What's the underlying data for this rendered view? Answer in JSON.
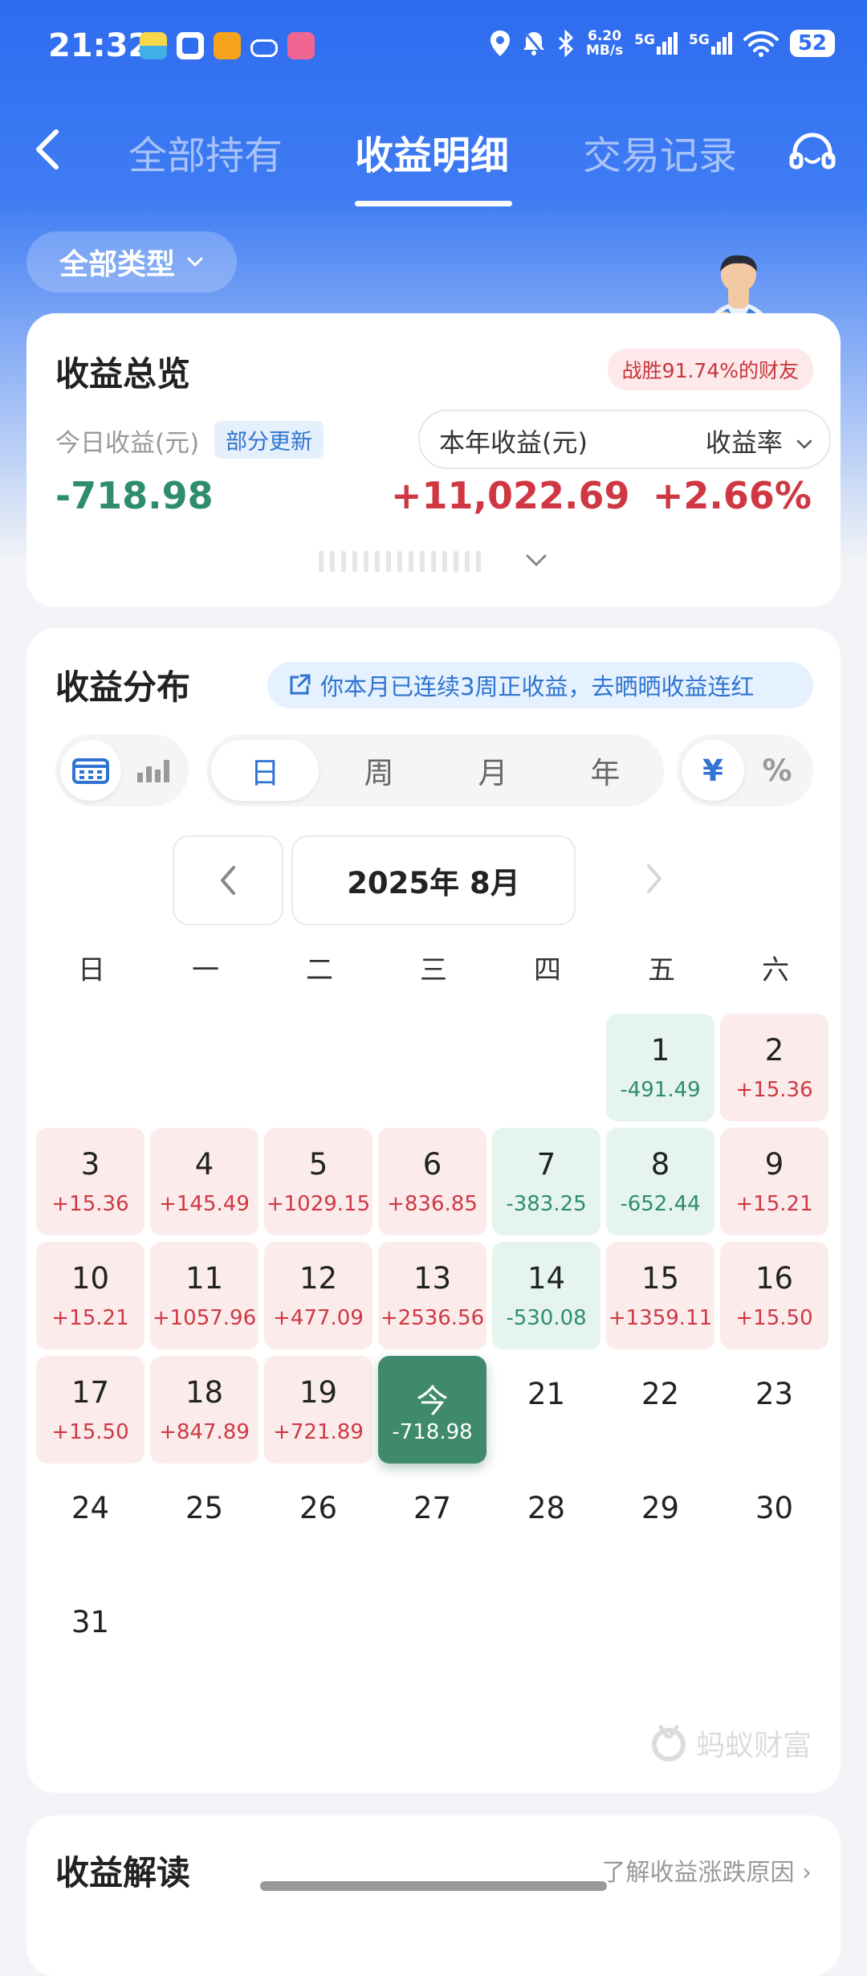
{
  "status_bar": {
    "time": "21:32",
    "net_speed_value": "6.20",
    "net_speed_unit": "MB/s",
    "sim1": "5G",
    "sim2": "5G",
    "battery": "52"
  },
  "nav": {
    "tabs": [
      {
        "label": "全部持有",
        "active": false
      },
      {
        "label": "收益明细",
        "active": true
      },
      {
        "label": "交易记录",
        "active": false
      }
    ]
  },
  "filter": {
    "type_label": "全部类型"
  },
  "overview": {
    "title": "收益总览",
    "win_badge": "战胜91.74%的财友",
    "today_label": "今日收益(元)",
    "partial_badge": "部分更新",
    "year_label": "本年收益(元)",
    "rate_label": "收益率",
    "today_value": "-718.98",
    "year_value": "+11,022.69",
    "rate_value": "+2.66%"
  },
  "distribution": {
    "title": "收益分布",
    "share_text": "你本月已连续3周正收益，去晒晒收益连红",
    "periods": [
      {
        "label": "日",
        "active": true
      },
      {
        "label": "周",
        "active": false
      },
      {
        "label": "月",
        "active": false
      },
      {
        "label": "年",
        "active": false
      }
    ],
    "currency": [
      {
        "label": "¥",
        "active": true
      },
      {
        "label": "%",
        "active": false
      }
    ],
    "month_label": "2025年 8月",
    "weekdays": [
      "日",
      "一",
      "二",
      "三",
      "四",
      "五",
      "六"
    ],
    "days": [
      {
        "day": "1",
        "value": "-491.49",
        "kind": "neg"
      },
      {
        "day": "2",
        "value": "+15.36",
        "kind": "pos"
      },
      {
        "day": "3",
        "value": "+15.36",
        "kind": "pos"
      },
      {
        "day": "4",
        "value": "+145.49",
        "kind": "pos"
      },
      {
        "day": "5",
        "value": "+1029.15",
        "kind": "pos"
      },
      {
        "day": "6",
        "value": "+836.85",
        "kind": "pos"
      },
      {
        "day": "7",
        "value": "-383.25",
        "kind": "neg"
      },
      {
        "day": "8",
        "value": "-652.44",
        "kind": "neg"
      },
      {
        "day": "9",
        "value": "+15.21",
        "kind": "pos"
      },
      {
        "day": "10",
        "value": "+15.21",
        "kind": "pos"
      },
      {
        "day": "11",
        "value": "+1057.96",
        "kind": "pos"
      },
      {
        "day": "12",
        "value": "+477.09",
        "kind": "pos"
      },
      {
        "day": "13",
        "value": "+2536.56",
        "kind": "pos"
      },
      {
        "day": "14",
        "value": "-530.08",
        "kind": "neg"
      },
      {
        "day": "15",
        "value": "+1359.11",
        "kind": "pos"
      },
      {
        "day": "16",
        "value": "+15.50",
        "kind": "pos"
      },
      {
        "day": "17",
        "value": "+15.50",
        "kind": "pos"
      },
      {
        "day": "18",
        "value": "+847.89",
        "kind": "pos"
      },
      {
        "day": "19",
        "value": "+721.89",
        "kind": "pos"
      },
      {
        "day": "今",
        "value": "-718.98",
        "kind": "today"
      },
      {
        "day": "21",
        "value": "",
        "kind": "plain"
      },
      {
        "day": "22",
        "value": "",
        "kind": "plain"
      },
      {
        "day": "23",
        "value": "",
        "kind": "plain"
      },
      {
        "day": "24",
        "value": "",
        "kind": "plain"
      },
      {
        "day": "25",
        "value": "",
        "kind": "plain"
      },
      {
        "day": "26",
        "value": "",
        "kind": "plain"
      },
      {
        "day": "27",
        "value": "",
        "kind": "plain"
      },
      {
        "day": "28",
        "value": "",
        "kind": "plain"
      },
      {
        "day": "29",
        "value": "",
        "kind": "plain"
      },
      {
        "day": "30",
        "value": "",
        "kind": "plain"
      },
      {
        "day": "31",
        "value": "",
        "kind": "plain"
      }
    ],
    "brand": "蚂蚁财富"
  },
  "interpretation": {
    "title": "收益解读",
    "link": "了解收益涨跌原因"
  },
  "colors": {
    "accent": "#2f74d0",
    "gain": "#cf3843",
    "loss": "#2f8c6c",
    "today_cell": "#3f8a6c"
  }
}
